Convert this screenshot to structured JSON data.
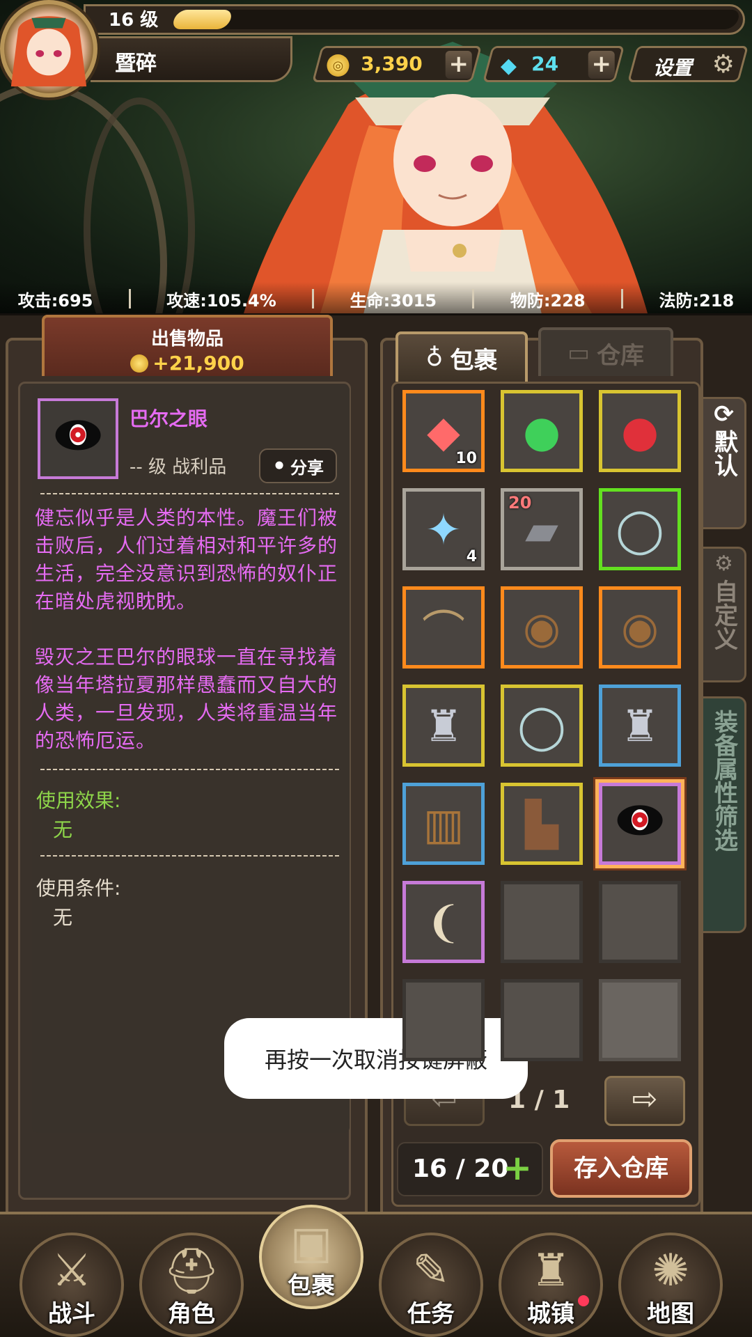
{
  "player": {
    "level_text": "16 级",
    "xp_progress": 0.1,
    "name": "暨碎"
  },
  "currency": {
    "gold": "3,390",
    "gold_plus": "+",
    "gems": "24",
    "gems_plus": "+",
    "settings_label": "设置"
  },
  "stats": [
    {
      "text": "攻击:695"
    },
    {
      "text": "攻速:105.4%"
    },
    {
      "text": "生命:3015"
    },
    {
      "text": "物防:228"
    },
    {
      "text": "法防:218"
    }
  ],
  "sell": {
    "title": "出售物品",
    "amount": "+21,900"
  },
  "item": {
    "name": "巴尔之眼",
    "sub": "-- 级 战利品",
    "share_label": "分享",
    "desc1": "健忘似乎是人类的本性。魔王们被击败后，人们过着相对和平许多的生活，完全没意识到恐怖的奴仆正在暗处虎视眈眈。",
    "desc2": "毁灭之王巴尔的眼球一直在寻找着像当年塔拉夏那样愚蠢而又自大的人类，一旦发现，人类将重温当年的恐怖厄运。",
    "effect_label": "使用效果:",
    "effect_value": "无",
    "condition_label": "使用条件:",
    "condition_value": "无"
  },
  "tabs": {
    "bag": "包裹",
    "warehouse": "仓库"
  },
  "side_tabs": {
    "default": "默认",
    "custom": "自定义",
    "filter": "装备属性筛选"
  },
  "inventory": [
    {
      "name": "crystal-red",
      "border": "orange",
      "glyph": "◆",
      "color": "#ff6a6a",
      "qty": "10",
      "lvl": ""
    },
    {
      "name": "gem-green",
      "border": "yellow",
      "glyph": "●",
      "color": "#3fd05a",
      "qty": "",
      "lvl": ""
    },
    {
      "name": "gem-red",
      "border": "yellow",
      "glyph": "●",
      "color": "#e0303a",
      "qty": "",
      "lvl": ""
    },
    {
      "name": "ice-shard",
      "border": "gray",
      "glyph": "✦",
      "color": "#8fd8ff",
      "qty": "4",
      "lvl": ""
    },
    {
      "name": "gauntlet",
      "border": "gray",
      "glyph": "▰",
      "color": "#8a8c92",
      "qty": "",
      "lvl": "20"
    },
    {
      "name": "ring",
      "border": "green",
      "glyph": "◯",
      "color": "#b6d6d8",
      "qty": "",
      "lvl": ""
    },
    {
      "name": "bow",
      "border": "orange",
      "glyph": "⌒",
      "color": "#b89a6a",
      "qty": "",
      "lvl": ""
    },
    {
      "name": "shield-wood",
      "border": "orange",
      "glyph": "◉",
      "color": "#9a6a3a",
      "qty": "",
      "lvl": ""
    },
    {
      "name": "shield-wood",
      "border": "orange",
      "glyph": "◉",
      "color": "#9a6a3a",
      "qty": "",
      "lvl": ""
    },
    {
      "name": "armor",
      "border": "yellow",
      "glyph": "♜",
      "color": "#c8ccd6",
      "qty": "",
      "lvl": ""
    },
    {
      "name": "ring",
      "border": "yellow",
      "glyph": "◯",
      "color": "#b6d6d8",
      "qty": "",
      "lvl": ""
    },
    {
      "name": "armor",
      "border": "blue",
      "glyph": "♜",
      "color": "#c8ccd6",
      "qty": "",
      "lvl": ""
    },
    {
      "name": "leg-armor",
      "border": "blue",
      "glyph": "▥",
      "color": "#a8743a",
      "qty": "",
      "lvl": ""
    },
    {
      "name": "boot",
      "border": "yellow",
      "glyph": "▙",
      "color": "#8a5a3a",
      "qty": "",
      "lvl": ""
    },
    {
      "name": "eye-of-baal",
      "border": "purple",
      "glyph": "eye",
      "color": "#000",
      "qty": "",
      "lvl": "",
      "selected": true
    },
    {
      "name": "fang",
      "border": "purple",
      "glyph": "❨",
      "color": "#e8dcc0",
      "qty": "",
      "lvl": ""
    },
    {
      "name": "empty",
      "border": "empty",
      "glyph": "",
      "color": "",
      "qty": "",
      "lvl": ""
    },
    {
      "name": "empty",
      "border": "empty",
      "glyph": "",
      "color": "",
      "qty": "",
      "lvl": ""
    },
    {
      "name": "empty",
      "border": "empty",
      "glyph": "",
      "color": "",
      "qty": "",
      "lvl": ""
    },
    {
      "name": "empty",
      "border": "empty",
      "glyph": "",
      "color": "",
      "qty": "",
      "lvl": ""
    },
    {
      "name": "empty",
      "border": "empty-light",
      "glyph": "",
      "color": "",
      "qty": "",
      "lvl": ""
    }
  ],
  "pager": {
    "text": "1 / 1",
    "prev_glyph": "⇦",
    "next_glyph": "⇨"
  },
  "capacity": {
    "text": "16 / 20",
    "plus": "+"
  },
  "store_button": "存入仓库",
  "toast": "再按一次取消按键屏蔽",
  "nav": [
    {
      "id": "battle",
      "label": "战斗",
      "icon": "⚔"
    },
    {
      "id": "character",
      "label": "角色",
      "icon": "⛑"
    },
    {
      "id": "bag",
      "label": "包裹",
      "icon": "▣",
      "active": true
    },
    {
      "id": "quest",
      "label": "任务",
      "icon": "✎"
    },
    {
      "id": "town",
      "label": "城镇",
      "icon": "♜",
      "badge": true
    },
    {
      "id": "map",
      "label": "地图",
      "icon": "✺"
    }
  ]
}
